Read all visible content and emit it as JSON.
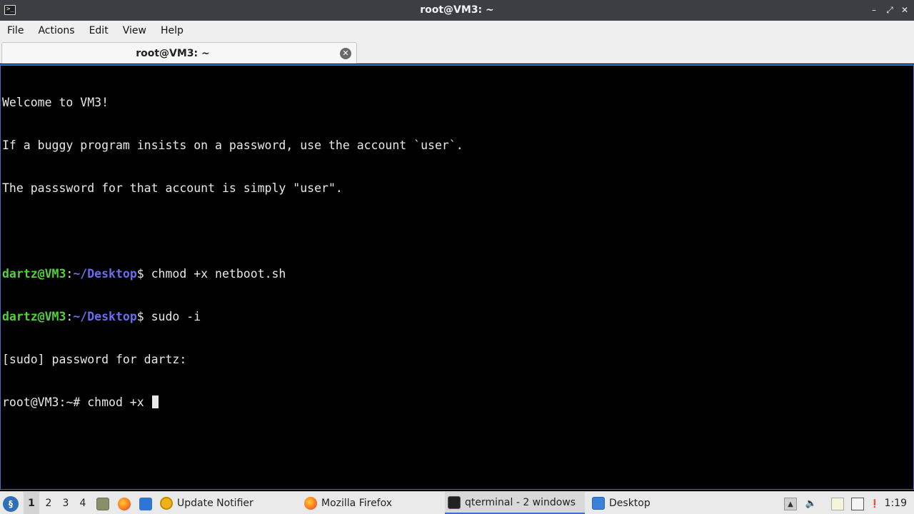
{
  "window": {
    "title": "root@VM3: ~",
    "app_icon_glyph": ">_",
    "minimize_glyph": "–",
    "maximize_glyph": "⤢",
    "close_glyph": "✕"
  },
  "menu": {
    "items": [
      "File",
      "Actions",
      "Edit",
      "View",
      "Help"
    ]
  },
  "tab": {
    "label": "root@VM3: ~",
    "close_glyph": "✕"
  },
  "terminal": {
    "line1": "Welcome to VM3!",
    "line2": "If a buggy program insists on a password, use the account `user`.",
    "line3": "The passsword for that account is simply \"user\".",
    "cmd1": {
      "user": "dartz@VM3",
      "sep": ":",
      "path": "~/Desktop",
      "suffix": "$ ",
      "command": "chmod +x netboot.sh"
    },
    "cmd2": {
      "user": "dartz@VM3",
      "sep": ":",
      "path": "~/Desktop",
      "suffix": "$ ",
      "command": "sudo -i"
    },
    "line6": "[sudo] password for dartz:",
    "line7": "root@VM3:~# chmod +x "
  },
  "taskbar": {
    "start_glyph": "§",
    "workspaces": [
      "1",
      "2",
      "3",
      "4"
    ],
    "active_workspace": "1",
    "tasks": {
      "update_notifier": "Update Notifier",
      "firefox": "Mozilla Firefox",
      "qterminal": "qterminal - 2 windows",
      "desktop": "Desktop"
    },
    "clock": "1:19"
  },
  "colors": {
    "accent": "#3f74c4",
    "prompt_user": "#55d03a",
    "prompt_path": "#6a6cf0"
  }
}
